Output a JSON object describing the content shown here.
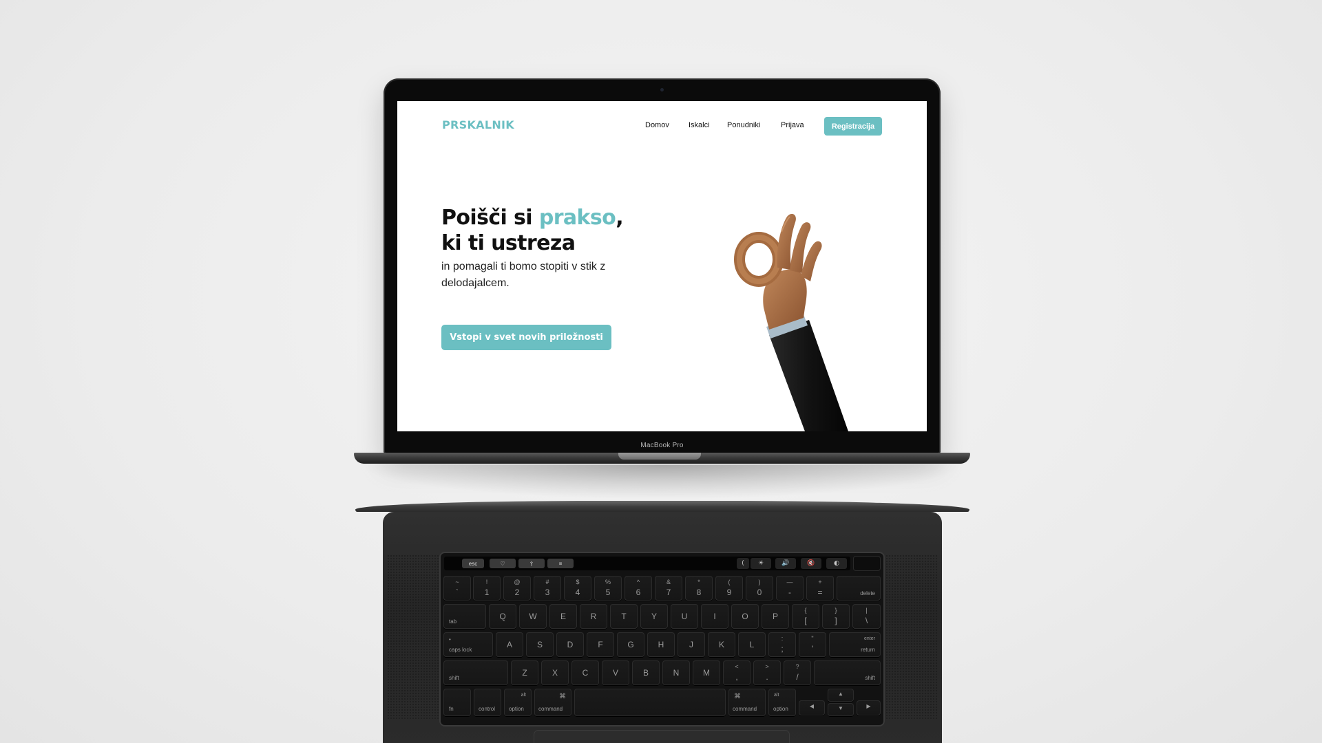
{
  "device": {
    "model_label": "MacBook Pro"
  },
  "site": {
    "logo": "PRSKALNIK",
    "nav": [
      {
        "label": "Domov"
      },
      {
        "label": "Iskalci"
      },
      {
        "label": "Ponudniki"
      },
      {
        "label": "Prijava"
      }
    ],
    "register_label": "Registracija",
    "hero": {
      "title_part1": "Poišči si ",
      "title_accent": "prakso",
      "title_part2": ",",
      "title_line2": "ki ti ustreza",
      "subtitle": "in pomagali ti bomo stopiti v stik z delodajalcem."
    },
    "cta_label": "Vstopi v svet novih priložnosti",
    "colors": {
      "accent": "#6bbfc2",
      "text": "#111111",
      "background": "#ffffff"
    }
  },
  "keyboard": {
    "touchbar": {
      "esc": "esc",
      "left_icons": [
        "heart-icon",
        "share-icon",
        "settings-icon"
      ],
      "right_icons": [
        "chevron-left-icon",
        "brightness-icon",
        "volume-icon",
        "mute-icon",
        "siri-icon"
      ]
    },
    "row1": [
      {
        "top": "~",
        "bottom": "`"
      },
      {
        "top": "!",
        "bottom": "1"
      },
      {
        "top": "@",
        "bottom": "2"
      },
      {
        "top": "#",
        "bottom": "3"
      },
      {
        "top": "$",
        "bottom": "4"
      },
      {
        "top": "%",
        "bottom": "5"
      },
      {
        "top": "^",
        "bottom": "6"
      },
      {
        "top": "&",
        "bottom": "7"
      },
      {
        "top": "*",
        "bottom": "8"
      },
      {
        "top": "(",
        "bottom": "9"
      },
      {
        "top": ")",
        "bottom": "0"
      },
      {
        "top": "—",
        "bottom": "-"
      },
      {
        "top": "+",
        "bottom": "="
      }
    ],
    "delete": "delete",
    "tab": "tab",
    "row2": [
      "Q",
      "W",
      "E",
      "R",
      "T",
      "Y",
      "U",
      "I",
      "O",
      "P"
    ],
    "row2_brackets": [
      {
        "top": "{",
        "bottom": "["
      },
      {
        "top": "}",
        "bottom": "]"
      },
      {
        "top": "|",
        "bottom": "\\"
      }
    ],
    "caps_lock": "caps lock",
    "row3": [
      "A",
      "S",
      "D",
      "F",
      "G",
      "H",
      "J",
      "K",
      "L"
    ],
    "row3_punct": [
      {
        "top": ":",
        "bottom": ";"
      },
      {
        "top": "\"",
        "bottom": "'"
      }
    ],
    "enter": "enter",
    "return": "return",
    "shift": "shift",
    "row4": [
      "Z",
      "X",
      "C",
      "V",
      "B",
      "N",
      "M"
    ],
    "row4_punct": [
      {
        "top": "<",
        "bottom": ","
      },
      {
        "top": ">",
        "bottom": "."
      },
      {
        "top": "?",
        "bottom": "/"
      }
    ],
    "fn": "fn",
    "control": "control",
    "alt": "alt",
    "option": "option",
    "command": "command",
    "cmd_symbol": "⌘",
    "arrows": {
      "left": "◀",
      "up": "▲",
      "down": "▼",
      "right": "▶"
    }
  }
}
